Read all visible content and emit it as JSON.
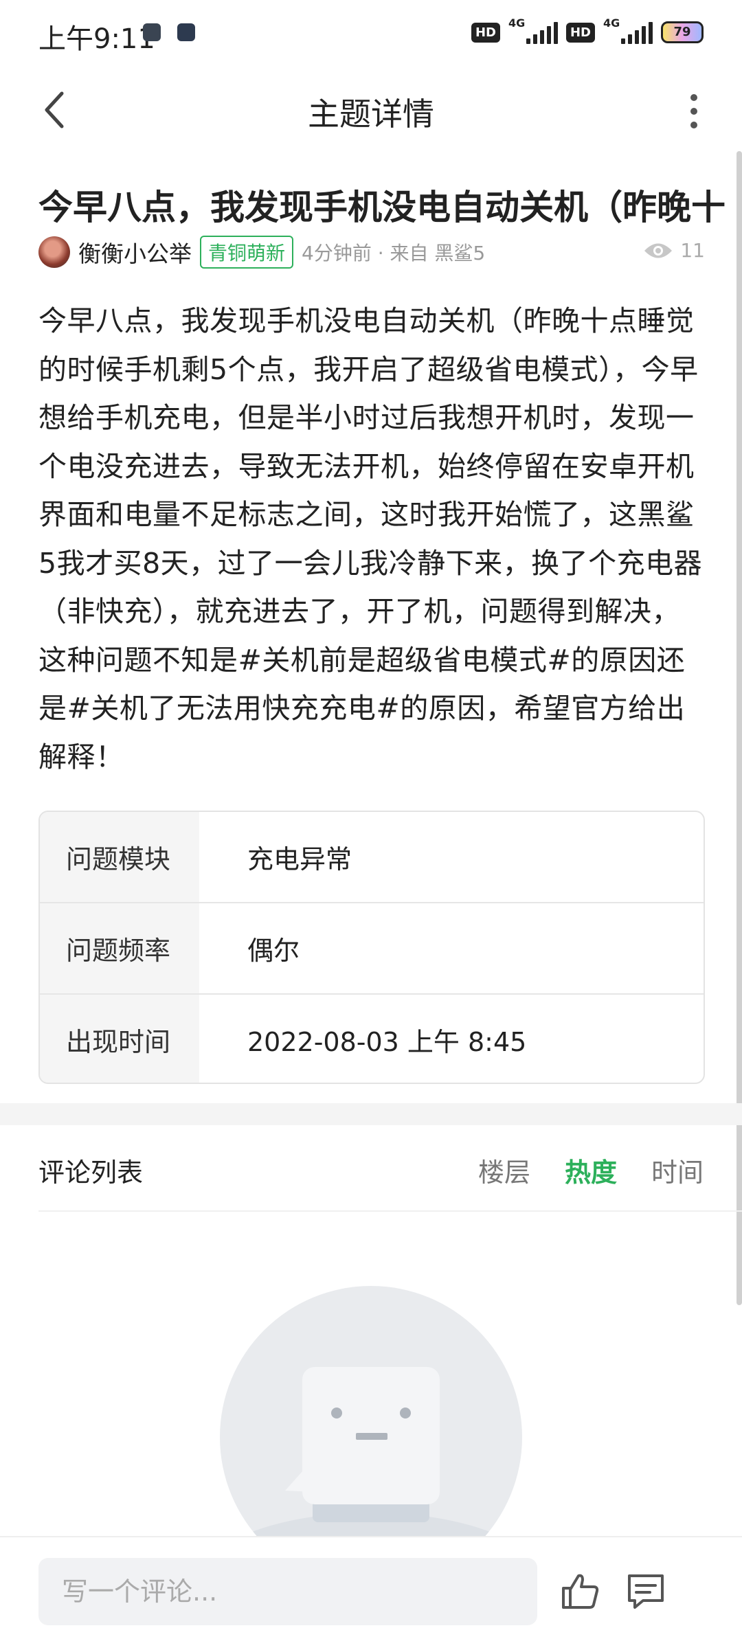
{
  "status_bar": {
    "time": "上午9:11",
    "hd1": "HD",
    "net1": "4G",
    "hd2": "HD",
    "net2": "4G",
    "battery": "79"
  },
  "header": {
    "title": "主题详情"
  },
  "post": {
    "title": "今早八点，我发现手机没电自动关机（昨晚十",
    "author": "衡衡小公举",
    "badge": "青铜萌新",
    "meta": "4分钟前 · 来自 黑鲨5",
    "views": "11",
    "body": "今早八点，我发现手机没电自动关机（昨晚十点睡觉的时候手机剩5个点，我开启了超级省电模式），今早想给手机充电，但是半小时过后我想开机时，发现一个电没充进去，导致无法开机，始终停留在安卓开机界面和电量不足标志之间，这时我开始慌了，这黑鲨5我才买8天，过了一会儿我冷静下来，换了个充电器（非快充），就充进去了，开了机，问题得到解决，这种问题不知是#关机前是超级省电模式#的原因还是#关机了无法用快充充电#的原因，希望官方给出解释！"
  },
  "info": [
    {
      "label": "问题模块",
      "value": "充电异常"
    },
    {
      "label": "问题频率",
      "value": "偶尔"
    },
    {
      "label": "出现时间",
      "value": "2022-08-03 上午 8:45"
    }
  ],
  "comments": {
    "title": "评论列表",
    "tabs": [
      "楼层",
      "热度",
      "时间"
    ],
    "active_tab": "热度"
  },
  "bottom": {
    "placeholder": "写一个评论..."
  },
  "colors": {
    "accent": "#2db05b",
    "muted": "#999999",
    "empty_bg": "#e9ebee"
  },
  "icons": [
    "back-arrow-icon",
    "more-vertical-icon",
    "eye-icon",
    "thumbs-up-icon",
    "comment-icon"
  ]
}
